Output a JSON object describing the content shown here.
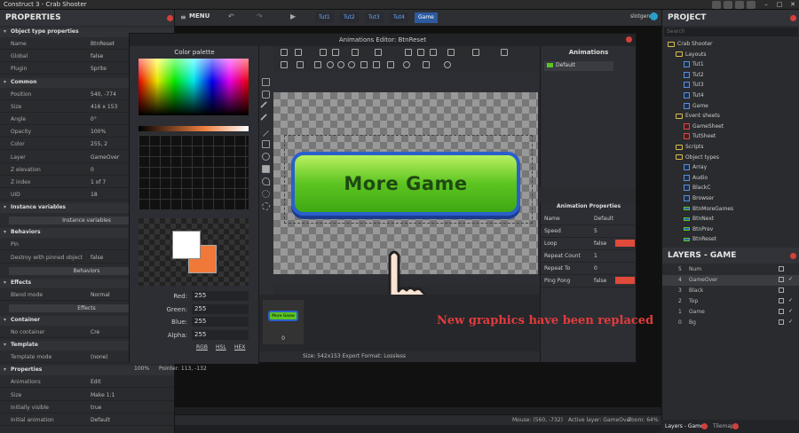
{
  "app": {
    "title": "Construct 3 - Crab Shooter"
  },
  "properties": {
    "heading": "PROPERTIES",
    "rows": [
      {
        "type": "sec",
        "label": "Object type properties"
      },
      {
        "type": "row",
        "k": "Name",
        "v": "BtnReset"
      },
      {
        "type": "row",
        "k": "Global",
        "v": "false"
      },
      {
        "type": "row",
        "k": "Plugin",
        "v": "Sprite"
      },
      {
        "type": "sec",
        "label": "Common"
      },
      {
        "type": "row",
        "k": "Position",
        "v": "540, -774"
      },
      {
        "type": "row",
        "k": "Size",
        "v": "416 x 153"
      },
      {
        "type": "row",
        "k": "Angle",
        "v": "0°"
      },
      {
        "type": "row",
        "k": "Opacity",
        "v": "100%"
      },
      {
        "type": "row",
        "k": "Color",
        "v": "255, 2"
      },
      {
        "type": "row",
        "k": "Layer",
        "v": "GameOver"
      },
      {
        "type": "row",
        "k": "Z elevation",
        "v": "0"
      },
      {
        "type": "row",
        "k": "Z index",
        "v": "1 of 7"
      },
      {
        "type": "row",
        "k": "UID",
        "v": "18"
      },
      {
        "type": "sec",
        "label": "Instance variables"
      },
      {
        "type": "btn",
        "label": "Instance variables"
      },
      {
        "type": "sec",
        "label": "Behaviors"
      },
      {
        "type": "row",
        "k": "Pin",
        "v": ""
      },
      {
        "type": "row",
        "k": "Destroy with pinned object",
        "v": "false"
      },
      {
        "type": "btn",
        "label": "Behaviors"
      },
      {
        "type": "sec",
        "label": "Effects"
      },
      {
        "type": "row",
        "k": "Blend mode",
        "v": "Normal"
      },
      {
        "type": "btn",
        "label": "Effects"
      },
      {
        "type": "sec",
        "label": "Container"
      },
      {
        "type": "row",
        "k": "No container",
        "v": "Cre"
      },
      {
        "type": "sec",
        "label": "Template"
      },
      {
        "type": "row",
        "k": "Template mode",
        "v": "(none)"
      },
      {
        "type": "sec",
        "label": "Properties"
      },
      {
        "type": "row",
        "k": "Animations",
        "v": "Edit"
      },
      {
        "type": "row",
        "k": "Size",
        "v": "Make 1:1"
      },
      {
        "type": "row",
        "k": "Initially visible",
        "v": "true"
      },
      {
        "type": "row",
        "k": "Initial animation",
        "v": "Default"
      }
    ]
  },
  "topbar": {
    "menu": "MENU",
    "tabs": [
      "Tut1",
      "Tut2",
      "Tut3",
      "Tut4",
      "Game"
    ],
    "active_tab": "Game",
    "user": "slotgen"
  },
  "status": {
    "mouse": "Mouse: (560, -732)",
    "layer": "Active layer: GameOver",
    "zoom": "Zoom: 64%"
  },
  "project": {
    "heading": "PROJECT",
    "search_placeholder": "Search",
    "tree": [
      {
        "label": "Crab Shooter",
        "kind": "folder",
        "lvl": 0
      },
      {
        "label": "Layouts",
        "kind": "folder",
        "lvl": 1
      },
      {
        "label": "Tut1",
        "kind": "item",
        "lvl": 2
      },
      {
        "label": "Tut2",
        "kind": "item",
        "lvl": 2
      },
      {
        "label": "Tut3",
        "kind": "item",
        "lvl": 2
      },
      {
        "label": "Tut4",
        "kind": "item",
        "lvl": 2
      },
      {
        "label": "Game",
        "kind": "item",
        "lvl": 2
      },
      {
        "label": "Event sheets",
        "kind": "folder",
        "lvl": 1
      },
      {
        "label": "GameSheet",
        "kind": "sheet",
        "lvl": 2
      },
      {
        "label": "TutSheet",
        "kind": "sheet",
        "lvl": 2
      },
      {
        "label": "Scripts",
        "kind": "folder",
        "lvl": 1
      },
      {
        "label": "Object types",
        "kind": "folder",
        "lvl": 1
      },
      {
        "label": "Array",
        "kind": "item",
        "lvl": 2
      },
      {
        "label": "Audio",
        "kind": "item",
        "lvl": 2
      },
      {
        "label": "BlackC",
        "kind": "item",
        "lvl": 2
      },
      {
        "label": "Browser",
        "kind": "item",
        "lvl": 2
      },
      {
        "label": "BtnMoreGames",
        "kind": "btn",
        "lvl": 2
      },
      {
        "label": "BtnNext",
        "kind": "btn",
        "lvl": 2
      },
      {
        "label": "BtnPrev",
        "kind": "btn",
        "lvl": 2
      },
      {
        "label": "BtnReset",
        "kind": "btn",
        "lvl": 2
      }
    ]
  },
  "layers": {
    "heading": "LAYERS - GAME",
    "rows": [
      {
        "n": "5",
        "name": "Num",
        "check": false
      },
      {
        "n": "4",
        "name": "GameOver",
        "check": true
      },
      {
        "n": "3",
        "name": "Black",
        "check": false
      },
      {
        "n": "2",
        "name": "Top",
        "check": true
      },
      {
        "n": "1",
        "name": "Game",
        "check": true
      },
      {
        "n": "0",
        "name": "Bg",
        "check": true
      }
    ],
    "tabs": [
      "Layers - Game",
      "Tilemap"
    ]
  },
  "dialog": {
    "title": "Animations Editor: BtnReset",
    "palette_heading": "Color palette",
    "rgb": [
      {
        "label": "Red:",
        "value": "255"
      },
      {
        "label": "Green:",
        "value": "255"
      },
      {
        "label": "Blue:",
        "value": "255"
      },
      {
        "label": "Alpha:",
        "value": "255"
      }
    ],
    "modes": [
      "RGB",
      "HSL",
      "HEX"
    ],
    "zoom_pct": "100%",
    "pointer": "Pointer: 113, -132",
    "size_info": "Size: 542x153   Export Format: Lossless",
    "button_text": "More Game",
    "animations_heading": "Animations",
    "animation_item": "Default",
    "anim_props_heading": "Animation Properties",
    "anim_props": [
      {
        "k": "Name",
        "v": "Default",
        "red": false
      },
      {
        "k": "Speed",
        "v": "5",
        "red": false
      },
      {
        "k": "Loop",
        "v": "false",
        "red": true
      },
      {
        "k": "Repeat Count",
        "v": "1",
        "red": false
      },
      {
        "k": "Repeat To",
        "v": "0",
        "red": false
      },
      {
        "k": "Ping Pong",
        "v": "false",
        "red": true
      }
    ],
    "frame_thumb_text": "More Game",
    "frame_number": "0",
    "note": "New graphics have been replaced"
  }
}
